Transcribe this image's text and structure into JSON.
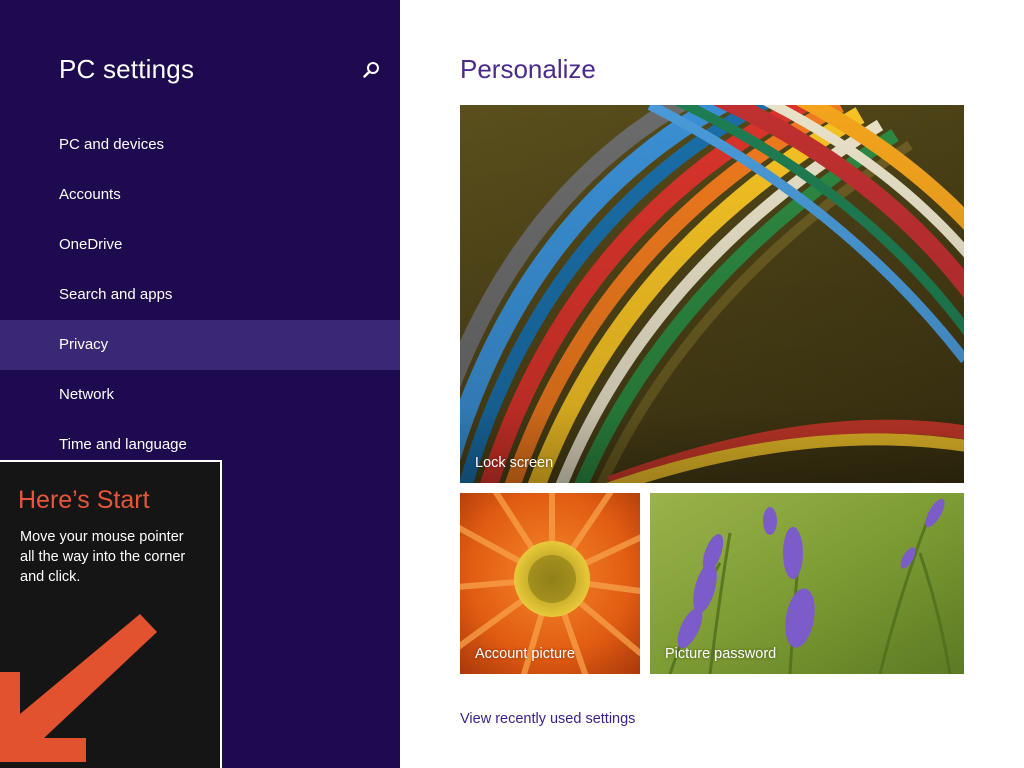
{
  "nav": {
    "title": "PC settings",
    "search_icon": "search-icon",
    "items": [
      {
        "label": "PC and devices",
        "selected": false
      },
      {
        "label": "Accounts",
        "selected": false
      },
      {
        "label": "OneDrive",
        "selected": false
      },
      {
        "label": "Search and apps",
        "selected": false
      },
      {
        "label": "Privacy",
        "selected": true
      },
      {
        "label": "Network",
        "selected": false
      },
      {
        "label": "Time and language",
        "selected": false
      }
    ]
  },
  "tip": {
    "title": "Here’s Start",
    "body": "Move your mouse pointer all the way into the corner and click.",
    "arrow_icon": "arrow-down-left-icon"
  },
  "main": {
    "title": "Personalize",
    "tiles": {
      "lock_screen": "Lock screen",
      "account_picture": "Account picture",
      "picture_password": "Picture password"
    },
    "recent_link": "View recently used settings"
  },
  "colors": {
    "nav_background": "#1e0a4e",
    "nav_selected": "#3a2776",
    "accent_title": "#4a2a8c",
    "tip_accent": "#e8553a",
    "tip_background": "#151515"
  }
}
